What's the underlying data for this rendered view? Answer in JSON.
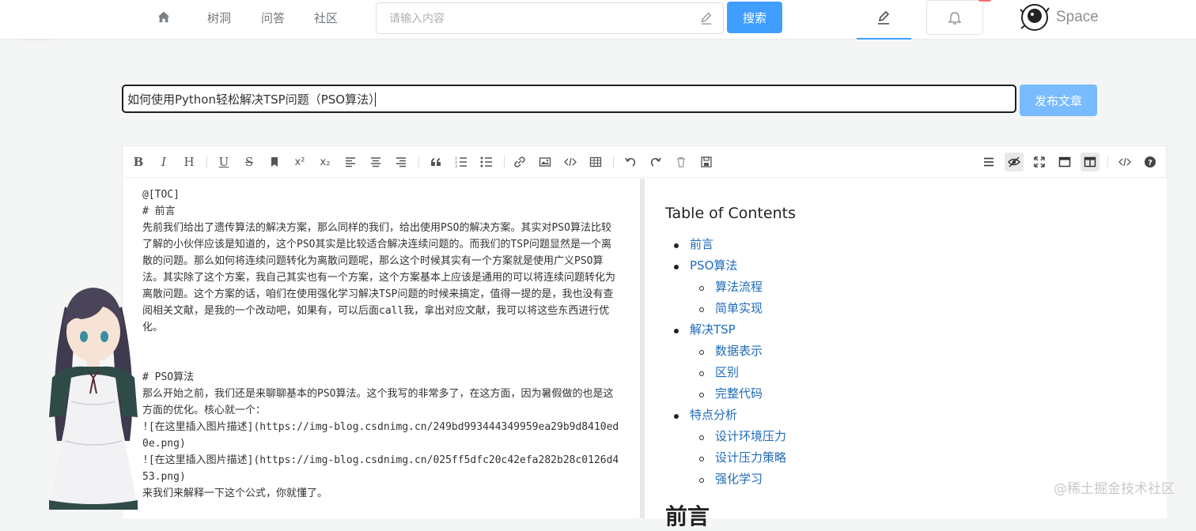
{
  "nav": {
    "links": [
      "树洞",
      "问答",
      "社区"
    ],
    "search_placeholder": "请输入内容",
    "search_button": "搜索",
    "brand": "Space"
  },
  "title": {
    "value": "如何使用Python轻松解决TSP问题（PSO算法）",
    "publish_button": "发布文章"
  },
  "editor": {
    "toolbar_left": [
      "bold-icon",
      "italic-icon",
      "heading-icon",
      "underline-icon",
      "strikethrough-icon",
      "bookmark-icon",
      "superscript-icon",
      "subscript-icon",
      "align-left-icon",
      "align-center-icon",
      "align-right-icon",
      "quote-icon",
      "ordered-list-icon",
      "unordered-list-icon",
      "link-icon",
      "image-icon",
      "code-icon",
      "table-icon",
      "undo-icon",
      "redo-icon",
      "trash-icon",
      "save-icon"
    ],
    "toolbar_right": [
      "toc-toggle-icon",
      "preview-icon",
      "fullscreen-icon",
      "window-icon",
      "split-view-icon",
      "source-code-icon",
      "help-icon"
    ],
    "markdown_lines": [
      "@[TOC]",
      "# 前言",
      "先前我们给出了遗传算法的解决方案，那么同样的我们，给出使用PSO的解决方案。其实对PSO算法比较了解的小伙伴应该是知道的，这个PSO其实是比较适合解决连续问题的。而我们的TSP问题显然是一个离散的问题。那么如何将连续问题转化为离散问题呢，那么这个时候其实有一个方案就是使用广义PSO算法。其实除了这个方案，我自己其实也有一个方案，这个方案基本上应该是通用的可以将连续问题转化为离散问题。这个方案的话，咱们在使用强化学习解决TSP问题的时候来搞定，值得一提的是，我也没有查阅相关文献，是我的一个改动吧，如果有，可以后面call我，拿出对应文献，我可以将这些东西进行优化。",
      "",
      "",
      "# PSO算法",
      "那么开始之前，我们还是来聊聊基本的PSO算法。这个我写的非常多了，在这方面，因为暑假做的也是这方面的优化。核心就一个：",
      "![在这里插入图片描述](https://img-blog.csdnimg.cn/249bd993444349959ea29b9d8410ed0e.png)",
      "![在这里插入图片描述](https://img-blog.csdnimg.cn/025ff5dfc20c42efa282b28c0126d453.png)",
      "来我们来解释一下这个公式，你就懂了。"
    ],
    "preview": {
      "toc_title": "Table of Contents",
      "toc": [
        {
          "label": "前言",
          "level": 1
        },
        {
          "label": "PSO算法",
          "level": 1
        },
        {
          "label": "算法流程",
          "level": 2
        },
        {
          "label": "简单实现",
          "level": 2
        },
        {
          "label": "解决TSP",
          "level": 1
        },
        {
          "label": "数据表示",
          "level": 2
        },
        {
          "label": "区别",
          "level": 2
        },
        {
          "label": "完整代码",
          "level": 2
        },
        {
          "label": "特点分析",
          "level": 1
        },
        {
          "label": "设计环境压力",
          "level": 2
        },
        {
          "label": "设计压力策略",
          "level": 2
        },
        {
          "label": "强化学习",
          "level": 2
        }
      ],
      "heading": "前言"
    }
  },
  "watermark": "@稀土掘金技术社区",
  "colors": {
    "accent": "#409eff",
    "publish": "#79bbff",
    "link": "#1e6bb8"
  }
}
